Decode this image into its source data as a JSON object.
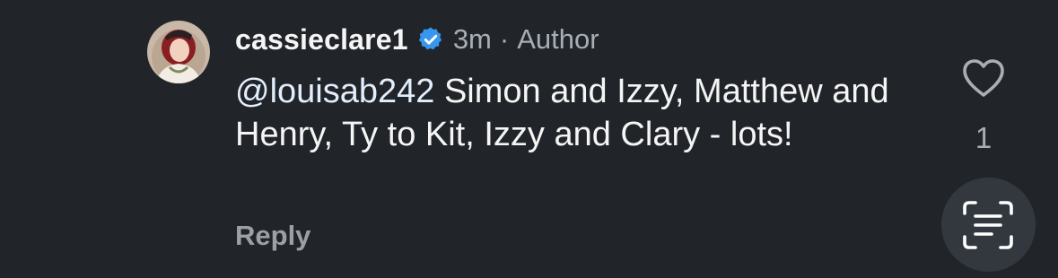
{
  "comment": {
    "username": "cassieclare1",
    "verified_icon": "verified-badge-icon",
    "time_ago": "3m",
    "separator": "·",
    "author_label": "Author",
    "mention": "@louisab242",
    "text": " Simon and Izzy, Matthew and Henry, Ty to Kit, Izzy and Clary - lots!",
    "reply_label": "Reply",
    "like_count": "1"
  },
  "icons": {
    "like": "heart-icon",
    "scan": "text-scan-icon",
    "avatar": "avatar"
  },
  "colors": {
    "background": "#212529",
    "verified": "#3797f0",
    "secondary_text": "#a8aeb5",
    "reply": "#9aa0a6",
    "scan_button_bg": "#33383e"
  }
}
